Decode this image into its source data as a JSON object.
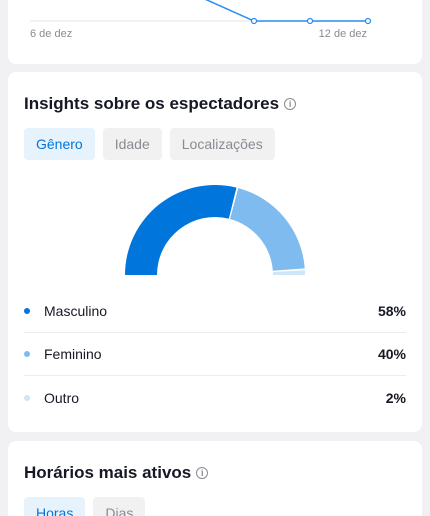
{
  "views_chart": {
    "axis_start": "6 de dez",
    "axis_end": "12 de dez",
    "line_color": "#2a8bf2"
  },
  "insights": {
    "title": "Insights sobre os espectadores",
    "info_icon": "info-icon",
    "tabs": [
      {
        "label": "Gênero",
        "active": true
      },
      {
        "label": "Idade",
        "active": false
      },
      {
        "label": "Localizações",
        "active": false
      }
    ],
    "gender": [
      {
        "label": "Masculino",
        "value": "58%",
        "share": 58,
        "color": "#0075db"
      },
      {
        "label": "Feminino",
        "value": "40%",
        "share": 40,
        "color": "#7fbbee"
      },
      {
        "label": "Outro",
        "value": "2%",
        "share": 2,
        "color": "#cfe5f8"
      }
    ]
  },
  "active_times": {
    "title": "Horários mais ativos",
    "info_icon": "info-icon",
    "tabs": [
      {
        "label": "Horas",
        "active": true
      },
      {
        "label": "Dias",
        "active": false
      }
    ]
  }
}
